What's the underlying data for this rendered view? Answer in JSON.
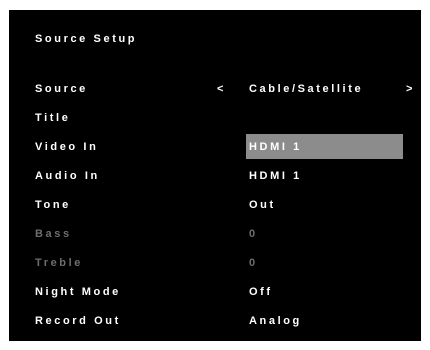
{
  "header": {
    "title": "Source Setup"
  },
  "rows": [
    {
      "label": "Source",
      "value": "Cable/Satellite",
      "left_arrow": "<",
      "right_arrow": ">"
    },
    {
      "label": "Title",
      "value": ""
    },
    {
      "label": "Video In",
      "value": "HDMI 1"
    },
    {
      "label": "Audio In",
      "value": "HDMI 1"
    },
    {
      "label": "Tone",
      "value": "Out"
    },
    {
      "label": "Bass",
      "value": "0"
    },
    {
      "label": "Treble",
      "value": "0"
    },
    {
      "label": "Night Mode",
      "value": "Off"
    },
    {
      "label": "Record Out",
      "value": "Analog"
    }
  ],
  "colors": {
    "background": "#000000",
    "text": "#ffffff",
    "disabled_text": "#6e6e6e",
    "highlight": "#8c8c8c"
  }
}
